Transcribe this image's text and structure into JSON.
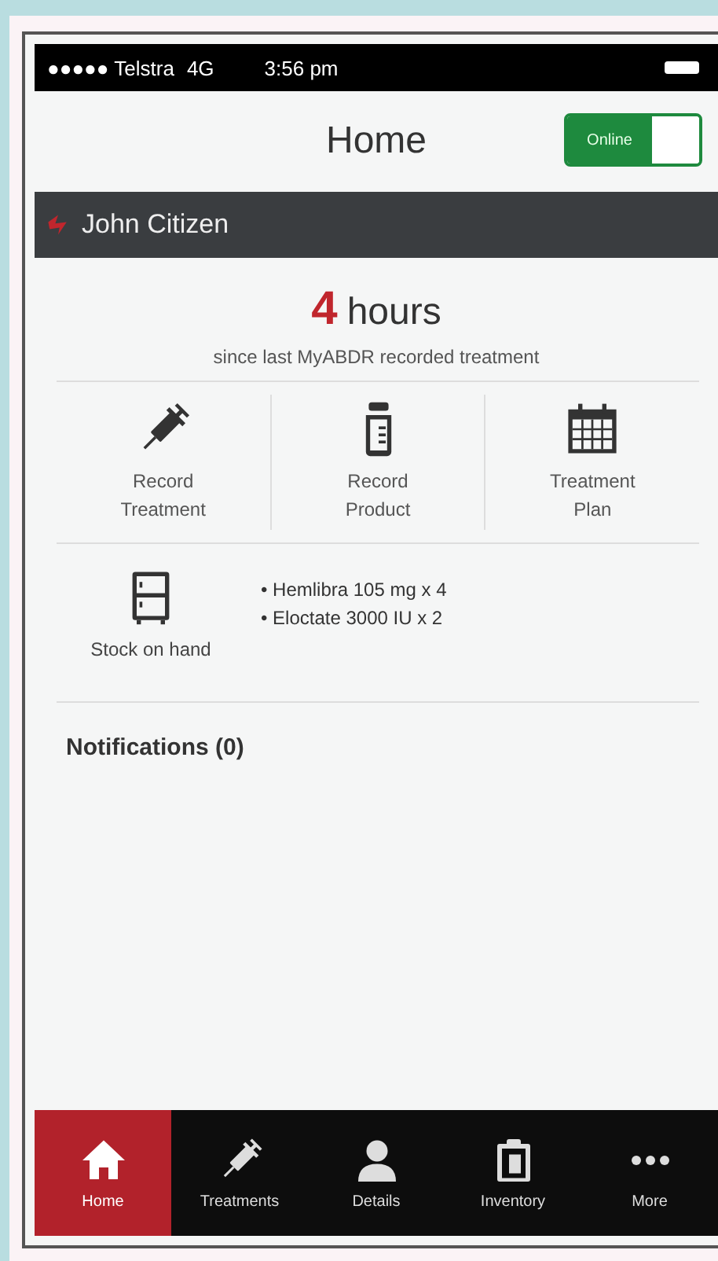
{
  "status_bar": {
    "carrier": "●●●●● Telstra",
    "network": "4G",
    "time": "3:56 pm"
  },
  "header": {
    "title": "Home",
    "toggle": {
      "label": "Online",
      "on": true
    }
  },
  "patient_bar": {
    "name": "John Citizen"
  },
  "summary": {
    "count": "4",
    "unit": "hours",
    "caption": "since last MyABDR recorded treatment"
  },
  "actions": [
    {
      "kind": "syringe",
      "label": "Record Treatment"
    },
    {
      "kind": "bottle",
      "label": "Record Product"
    },
    {
      "kind": "calendar",
      "label": "Treatment Plan"
    }
  ],
  "stock": {
    "label": "Stock on hand",
    "items": [
      "• Hemlibra 105 mg x 4",
      "• Eloctate 3000 IU x 2"
    ]
  },
  "notifications": {
    "title": "Notifications (0)"
  },
  "tab_bar": [
    {
      "kind": "home",
      "label": "Home",
      "selected": true
    },
    {
      "kind": "syringe",
      "label": "Treatments",
      "selected": false
    },
    {
      "kind": "person",
      "label": "Details",
      "selected": false
    },
    {
      "kind": "clipboard",
      "label": "Inventory",
      "selected": false
    },
    {
      "kind": "dots",
      "label": "More",
      "selected": false
    }
  ]
}
